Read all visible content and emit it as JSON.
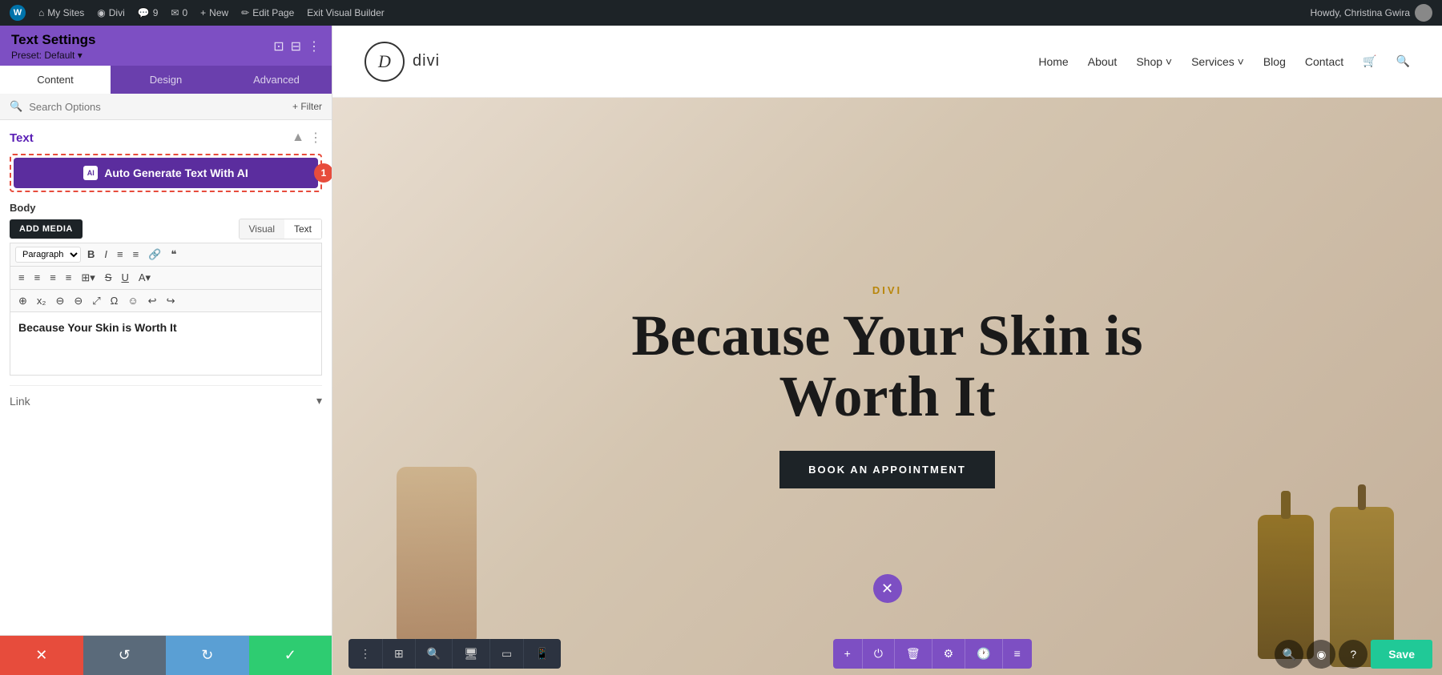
{
  "admin_bar": {
    "wp_logo": "W",
    "my_sites": "My Sites",
    "divi": "Divi",
    "comments_count": "9",
    "messages_count": "0",
    "new_label": "New",
    "edit_page": "Edit Page",
    "exit_builder": "Exit Visual Builder",
    "howdy": "Howdy, Christina Gwira"
  },
  "left_panel": {
    "title": "Text Settings",
    "preset": "Preset: Default ▾",
    "tabs": [
      "Content",
      "Design",
      "Advanced"
    ],
    "active_tab": "Content",
    "search_placeholder": "Search Options",
    "filter_label": "+ Filter",
    "section_text": "Text",
    "ai_button_label": "Auto Generate Text With AI",
    "ai_badge": "1",
    "body_label": "Body",
    "add_media": "ADD MEDIA",
    "editor_tab_visual": "Visual",
    "editor_tab_text": "Text",
    "paragraph_select": "Paragraph",
    "toolbar_icons_row1": [
      "B",
      "I",
      "≡",
      "≡",
      "🔗",
      "❝"
    ],
    "toolbar_icons_row2": [
      "≡",
      "≡",
      "≡",
      "≡",
      "⊞",
      "S̶",
      "U̲",
      "A"
    ],
    "toolbar_icons_row3": [
      "⊕",
      "ₓ",
      "⊖",
      "⊖",
      "⤢",
      "Ω",
      "☺",
      "↩",
      "↪"
    ],
    "editor_content": "Because Your Skin is Worth It",
    "link_label": "Link",
    "footer_buttons": {
      "cancel": "✕",
      "undo": "↺",
      "redo": "↻",
      "confirm": "✓"
    }
  },
  "site_nav": {
    "logo_letter": "D",
    "logo_name": "divi",
    "menu_items": [
      "Home",
      "About",
      "Shop ˅",
      "Services ˅",
      "Blog",
      "Contact"
    ],
    "cart_icon": "🛒",
    "search_icon": "🔍"
  },
  "hero": {
    "brand": "DIVI",
    "title": "Because Your Skin is Worth It",
    "cta": "BOOK AN APPOINTMENT"
  },
  "bottom_toolbars": {
    "left_icons": [
      "⋮",
      "⊞",
      "🔍",
      "🖥",
      "▭",
      "📱"
    ],
    "middle_icons": [
      "+",
      "⏻",
      "🗑",
      "⚙",
      "🕐",
      "≡"
    ],
    "right_save": "Save"
  }
}
